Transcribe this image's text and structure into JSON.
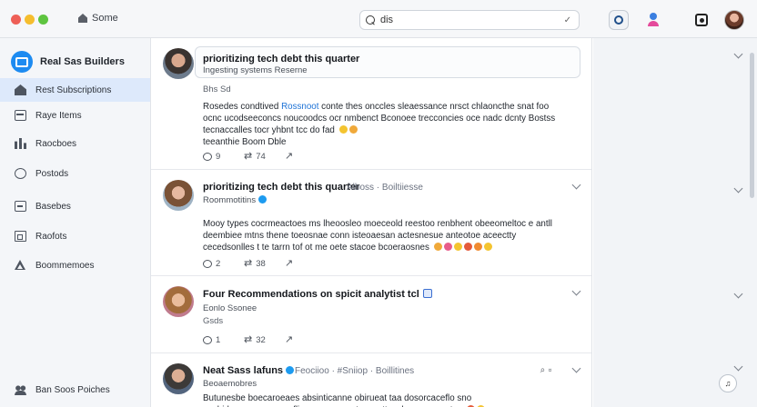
{
  "titlebar": {
    "tab_label": "Some",
    "search_value": "dis",
    "search_clear": "✓"
  },
  "sidebar": {
    "brand": "Real Sas Builders",
    "items": [
      {
        "label": "Rest Subscriptions",
        "icon": "home-icon",
        "active": true
      },
      {
        "label": "Raye Items",
        "icon": "calendar-icon",
        "active": false
      },
      {
        "label": "Raocboes",
        "icon": "chart-icon",
        "active": false
      },
      {
        "label": "Postods",
        "icon": "circle-icon",
        "active": false
      },
      {
        "label": "Basebes",
        "icon": "inbox-icon",
        "active": false
      },
      {
        "label": "Raofots",
        "icon": "document-icon",
        "active": false
      },
      {
        "label": "Boommemoes",
        "icon": "triangle-icon",
        "active": false
      }
    ],
    "footer": "Ban Soos Poiches"
  },
  "feed": {
    "posts": [
      {
        "title": "prioritizing tech debt this quarter",
        "sub": "Ingesting systems Reserne",
        "time": "Bhs Sd",
        "body_pre": "Rosedes condtived ",
        "body_link": "Rossnoot",
        "body_post": " conte thes onccles sleaessance nrsct chlaoncthe snat foo ocnc ucodseeconcs noucoodcs ocr nmbenct Bconoee trecconcies oce nadc dcnty Bostss tecnaccalles tocr yhbnt tcc do fad",
        "body_tail": "teeanthie Boom Dble",
        "replies": "9",
        "reposts": "74",
        "shares": ""
      },
      {
        "title": "prioritizing tech debt this quarter",
        "meta": "Alboss · Boiltiiesse",
        "sub": "Roommotitins",
        "body": "Mooy types cocrmeactoes ms lheoosleo moeceold reestoo renbhent obeeomeltoc e antll deembiee mtns thene toeosnae conn isteoaesan actesnesue anteotoe aceectty cecedsonlles t te tarrn tof ot me oete stacoe bcoeraosnes",
        "replies": "2",
        "reposts": "38",
        "shares": ""
      },
      {
        "title": "Four Recommendations on spicit analytist tcl",
        "sub": "Eonlo Ssonee",
        "time": "Gsds",
        "replies": "1",
        "reposts": "32",
        "shares": ""
      },
      {
        "title": "Neat Sass lafuns",
        "meta": "Feociioo · #Sniiop · Boillitines",
        "sub": "Beoaemobres",
        "body": "Butunesbe boecaroeaes absinticanne obirueat taa dosorcaceflo sno acobidonsenoomercoeflinoe aon oaos tcse rsttecebeeo sesoe tes"
      }
    ]
  },
  "colors": {
    "accent": "#1d8bf1",
    "active_nav": "#dde9fb",
    "link": "#1d72d6"
  }
}
